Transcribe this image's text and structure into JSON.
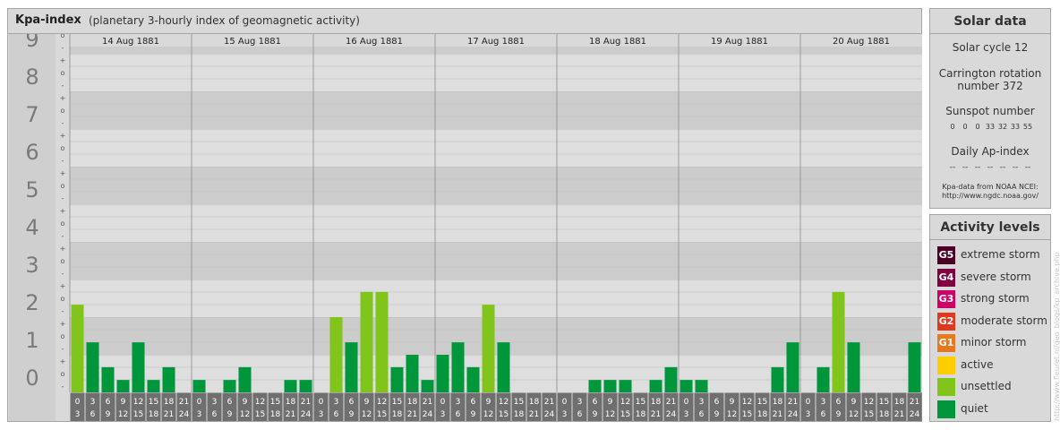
{
  "header": {
    "title": "Kpa-index",
    "subtitle": "(planetary 3-hourly index of geomagnetic activity)"
  },
  "chart_data": {
    "type": "bar",
    "kp_levels": [
      "0",
      "1",
      "2",
      "3",
      "4",
      "5",
      "6",
      "7",
      "8",
      "9"
    ],
    "sub_marks": [
      "-",
      "o",
      "+"
    ],
    "days": [
      "14 Aug 1881",
      "15 Aug 1881",
      "16 Aug 1881",
      "17 Aug 1881",
      "18 Aug 1881",
      "19 Aug 1881",
      "20 Aug 1881"
    ],
    "interval_starts": [
      "0",
      "3",
      "6",
      "9",
      "12",
      "15",
      "18",
      "21"
    ],
    "interval_ends": [
      "3",
      "6",
      "9",
      "12",
      "15",
      "18",
      "21",
      "24"
    ],
    "ylim": [
      0,
      9.33
    ],
    "values": [
      [
        2.33,
        1.33,
        0.67,
        0.33,
        1.33,
        0.33,
        0.67,
        0
      ],
      [
        0.33,
        0,
        0.33,
        0.67,
        0,
        0,
        0.33,
        0.33
      ],
      [
        0,
        2,
        1.33,
        2.67,
        2.67,
        0.67,
        1,
        0.33
      ],
      [
        1,
        1.33,
        0.67,
        2.33,
        1.33,
        0,
        0,
        0
      ],
      [
        0,
        0,
        0.33,
        0.33,
        0.33,
        0,
        0.33,
        0.67
      ],
      [
        0.33,
        0.33,
        0,
        0,
        0,
        0,
        0.67,
        1.33
      ],
      [
        0,
        0.67,
        2.67,
        1.33,
        0,
        0,
        0,
        1.33
      ]
    ]
  },
  "solar": {
    "title": "Solar data",
    "cycle": "Solar cycle 12",
    "carrington_line1": "Carrington rotation",
    "carrington_line2": "number 372",
    "sunspot_label": "Sunspot number",
    "sunspot_values": [
      "0",
      "0",
      "0",
      "33",
      "32",
      "33",
      "55"
    ],
    "ap_label": "Daily Ap-index",
    "ap_values": [
      "--",
      "--",
      "--",
      "--",
      "--",
      "--",
      "--"
    ],
    "source_line1": "Kpa-data from NOAA NCEI:",
    "source_line2": "http://www.ngdc.noaa.gov/"
  },
  "activity": {
    "title": "Activity levels",
    "levels": [
      {
        "code": "G5",
        "label": "extreme storm",
        "color": "#4d0026"
      },
      {
        "code": "G4",
        "label": "severe storm",
        "color": "#800040"
      },
      {
        "code": "G3",
        "label": "strong storm",
        "color": "#cc0066"
      },
      {
        "code": "G2",
        "label": "moderate storm",
        "color": "#e03a1e"
      },
      {
        "code": "G1",
        "label": "minor storm",
        "color": "#e8781e"
      },
      {
        "code": "",
        "label": "active",
        "color": "#ffcc00"
      },
      {
        "code": "",
        "label": "unsettled",
        "color": "#80c41c"
      },
      {
        "code": "",
        "label": "quiet",
        "color": "#00963c"
      }
    ]
  },
  "watermark": "http://www.fleuret.nl/geo_blogs/kp_archive.php"
}
